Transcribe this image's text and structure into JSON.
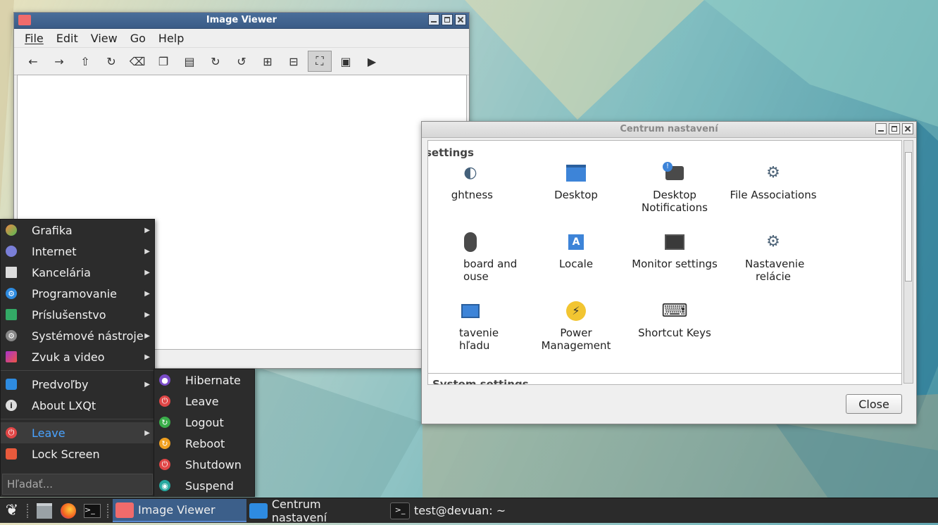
{
  "image_viewer": {
    "title": "Image Viewer",
    "menu": [
      "File",
      "Edit",
      "View",
      "Go",
      "Help"
    ],
    "toolbar_icons": [
      "back-arrow-icon",
      "forward-arrow-icon",
      "upload-icon",
      "reload-icon",
      "delete-icon",
      "copy-icon",
      "paste-icon",
      "rotate-right-icon",
      "rotate-left-icon",
      "zoom-in-icon",
      "zoom-out-icon",
      "fit-to-window-icon",
      "original-size-icon",
      "play-slideshow-icon"
    ]
  },
  "settings": {
    "title": "Centrum nastavení",
    "group_title": "settings",
    "group_title2": "System settings",
    "items": [
      {
        "label": "ghtness",
        "icon": "brightness-icon"
      },
      {
        "label": "Desktop",
        "icon": "desktop-icon"
      },
      {
        "label": "Desktop Notifications",
        "icon": "notification-icon"
      },
      {
        "label": "File Associations",
        "icon": "gear-icon"
      },
      {
        "label": "board and ouse",
        "icon": "mouse-icon"
      },
      {
        "label": "Locale",
        "icon": "locale-icon"
      },
      {
        "label": "Monitor settings",
        "icon": "monitor-icon"
      },
      {
        "label": "Nastavenie relácie",
        "icon": "gear-icon"
      },
      {
        "label": "tavenie hľadu",
        "icon": "appearance-icon"
      },
      {
        "label": "Power Management",
        "icon": "power-icon"
      },
      {
        "label": "Shortcut Keys",
        "icon": "keyboard-icon"
      }
    ],
    "close_label": "Close"
  },
  "start_menu": {
    "categories": [
      "Grafika",
      "Internet",
      "Kancelária",
      "Programovanie",
      "Príslušenstvo",
      "Systémové nástroje",
      "Zvuk a video"
    ],
    "preferences": "Predvoľby",
    "about": "About LXQt",
    "leave": "Leave",
    "lock": "Lock Screen",
    "search_placeholder": "Hľadať..."
  },
  "leave_menu": [
    "Hibernate",
    "Leave",
    "Logout",
    "Reboot",
    "Shutdown",
    "Suspend"
  ],
  "taskbar": {
    "tasks": [
      "Image Viewer",
      "Centrum nastavení",
      "test@devuan: ~"
    ]
  },
  "colors": {
    "accent": "#4aa3ff",
    "titlebar_active": "#3a5b86",
    "menu_bg": "#2c2c2c"
  }
}
